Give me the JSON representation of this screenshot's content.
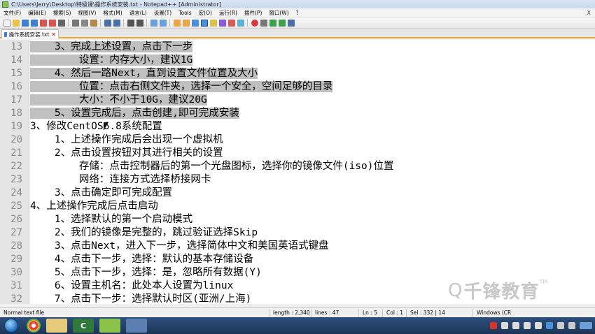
{
  "window": {
    "title": "C:\\Users\\Jerry\\Desktop\\特级课\\操作系统安装.txt - Notepad++ [Administrator]"
  },
  "menu": {
    "items": [
      "文件(F)",
      "编辑(E)",
      "搜索(S)",
      "视图(V)",
      "格式(M)",
      "语言(L)",
      "设置(T)",
      "Tools",
      "宏(O)",
      "运行(R)",
      "插件(P)",
      "窗口(W)",
      "?"
    ],
    "close_glyph": "X"
  },
  "tab": {
    "label": "操作系统安装.txt",
    "close_glyph": "✕"
  },
  "editor": {
    "lines": [
      {
        "num": "13",
        "text": "    3、完成上述设置，点击下一步",
        "selected": true
      },
      {
        "num": "14",
        "text": "        设置：内存大小，建议1G",
        "selected": true
      },
      {
        "num": "15",
        "text": "    4、然后一路Next，直到设置文件位置及大小",
        "selected": true
      },
      {
        "num": "16",
        "text": "        位置：点击右侧文件夹，选择一个安全，空间足够的目录",
        "selected": true
      },
      {
        "num": "17",
        "text": "        大小：不小于10G，建议20G",
        "selected": true
      },
      {
        "num": "18",
        "text": "    5、设置完成后，点击创建,即可完成安装",
        "selected": true
      },
      {
        "num": "19",
        "text": "3、修改CentOS6.8系统配置",
        "selected": false
      },
      {
        "num": "20",
        "text": "    1、上述操作完成后会出现一个虚拟机",
        "selected": false
      },
      {
        "num": "21",
        "text": "    2、点击设置按钮对其进行相关的设置",
        "selected": false
      },
      {
        "num": "22",
        "text": "        存储：点击控制器后的第一个光盘图标，选择你的镜像文件(iso)位置",
        "selected": false
      },
      {
        "num": "23",
        "text": "        网络：连接方式选择桥接网卡",
        "selected": false
      },
      {
        "num": "24",
        "text": "    3、点击确定即可完成配置",
        "selected": false
      },
      {
        "num": "25",
        "text": "4、上述操作完成后点击启动",
        "selected": false
      },
      {
        "num": "26",
        "text": "    1、选择默认的第一个启动模式",
        "selected": false
      },
      {
        "num": "27",
        "text": "    2、我们的镜像是完整的，跳过验证选择Skip",
        "selected": false
      },
      {
        "num": "28",
        "text": "    3、点击Next，进入下一步，选择简体中文和美国英语式键盘",
        "selected": false
      },
      {
        "num": "29",
        "text": "    4、点击下一步，选择：默认的基本存储设备",
        "selected": false
      },
      {
        "num": "30",
        "text": "    5、点击下一步，选择：是，忽略所有数据(Y)",
        "selected": false
      },
      {
        "num": "31",
        "text": "    6、设置主机名：此处本人设置为linux",
        "selected": false
      },
      {
        "num": "32",
        "text": "    7、点击下一步：选择默认时区(亚洲/上海)",
        "selected": false
      }
    ]
  },
  "watermark": {
    "text": "千锋教育",
    "tm": "TM"
  },
  "status": {
    "file_type": "Normal text file",
    "length": "length : 2,340",
    "lines": "lines : 47",
    "ln": "Ln : 5",
    "col": "Col : 1",
    "sel": "Sel : 332 | 14",
    "eol": "Windows (CR"
  },
  "taskbar": {
    "apps": [
      "C"
    ]
  },
  "colors": {
    "selection": "#c0c0c0",
    "tab_accent": "#f7a531",
    "taskbar": "#1c3556"
  }
}
